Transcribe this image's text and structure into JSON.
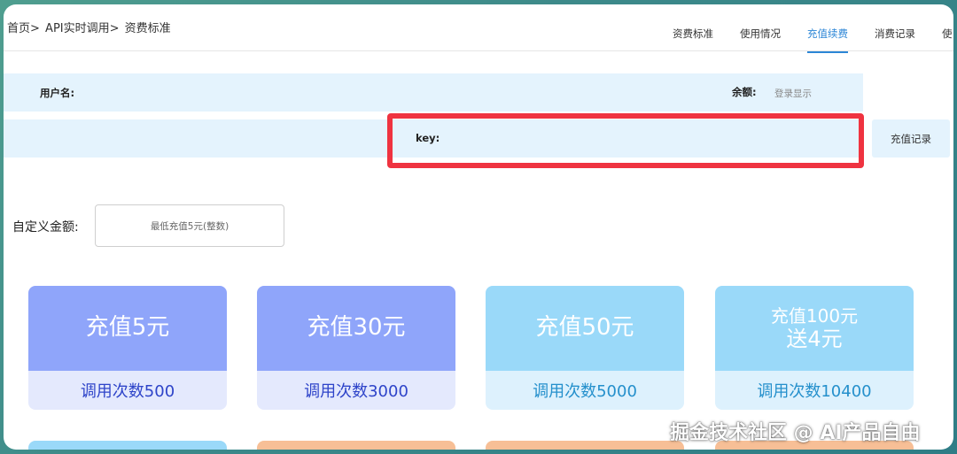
{
  "breadcrumb": {
    "home": "首页>",
    "api": "API实时调用>",
    "current": "资费标准"
  },
  "tabs": [
    {
      "label": "资费标准"
    },
    {
      "label": "使用情况"
    },
    {
      "label": "充值续费",
      "active": true
    },
    {
      "label": "消费记录"
    },
    {
      "label": "使"
    }
  ],
  "account": {
    "username_label": "用户名:",
    "balance_label": "余额:",
    "balance_hint": "登录显示",
    "key_label": "key:",
    "recharge_record_button": "充值记录"
  },
  "custom_amount": {
    "label": "自定义金额:",
    "placeholder": "最低充值5元(整数)"
  },
  "packages": [
    {
      "title": "充值5元",
      "calls": "调用次数500",
      "style": "purple"
    },
    {
      "title": "充值30元",
      "calls": "调用次数3000",
      "style": "purple"
    },
    {
      "title": "充值50元",
      "calls": "调用次数5000",
      "style": "blue"
    },
    {
      "title_line1": "充值100元",
      "title_line2": "送4元",
      "calls": "调用次数10400",
      "style": "blue"
    }
  ],
  "partial_cards_colors": [
    "#9ad9f9",
    "#f7bf96",
    "#f7bf96",
    "#f7bf96"
  ],
  "colors": {
    "accent": "#2c86d6",
    "highlight_border": "#ef3340",
    "row_bg": "#e4f3fd"
  },
  "watermark": "掘金技术社区 @ AI产品自由"
}
